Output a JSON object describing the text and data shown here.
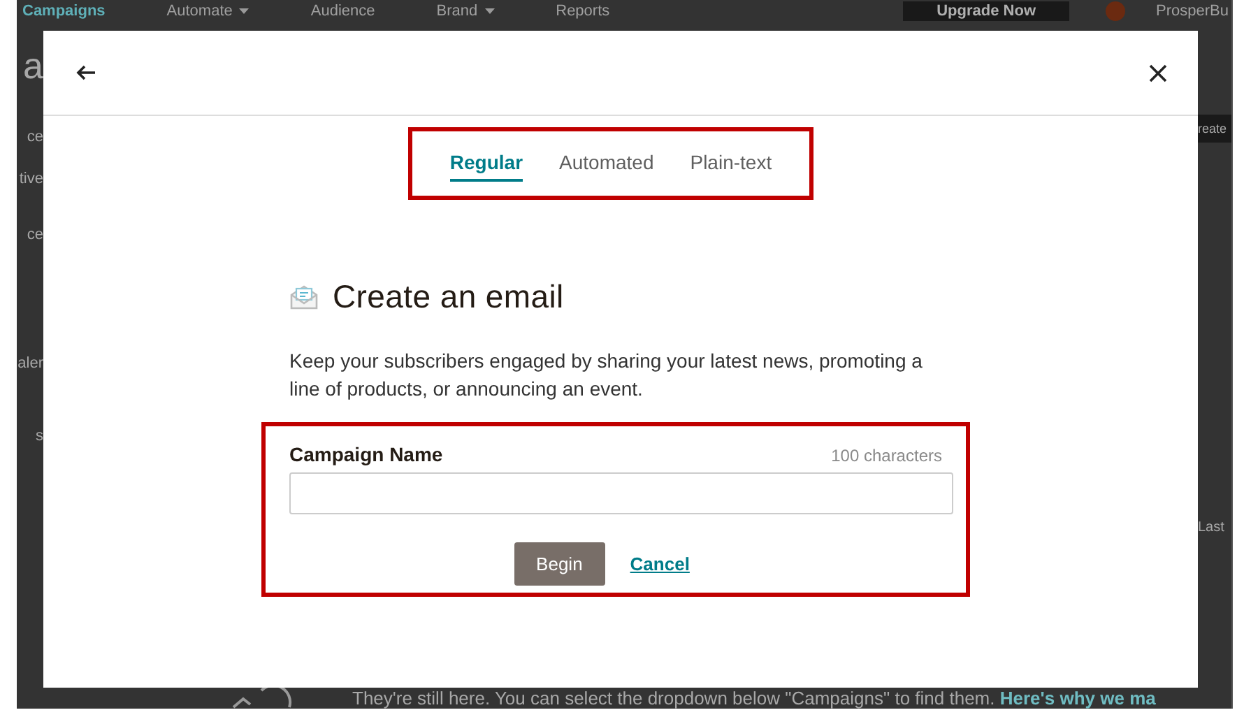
{
  "background": {
    "nav": [
      {
        "label": "Campaigns",
        "active": true,
        "dropdown": false
      },
      {
        "label": "Automate",
        "active": false,
        "dropdown": true
      },
      {
        "label": "Audience",
        "active": false,
        "dropdown": false
      },
      {
        "label": "Brand",
        "active": false,
        "dropdown": true
      },
      {
        "label": "Reports",
        "active": false,
        "dropdown": false
      }
    ],
    "upgrade_button": "Upgrade Now",
    "account_name": "ProsperBu",
    "left_fragments": [
      "a",
      "ce",
      "tive",
      "ce",
      "aler",
      "s"
    ],
    "right_fragments": [
      "reate",
      "Last"
    ],
    "notice": {
      "text": "They're still here. You can select the dropdown below \"Campaigns\" to find them.",
      "link": "Here's why we ma"
    }
  },
  "modal": {
    "tabs": [
      {
        "label": "Regular",
        "selected": true
      },
      {
        "label": "Automated",
        "selected": false
      },
      {
        "label": "Plain-text",
        "selected": false
      }
    ],
    "heading": "Create an email",
    "description": "Keep your subscribers engaged by sharing your latest news, promoting a line of products, or announcing an event.",
    "field": {
      "label": "Campaign Name",
      "counter": "100 characters"
    },
    "buttons": [
      {
        "kind": "primary",
        "label": "Begin"
      },
      {
        "kind": "link",
        "label": "Cancel"
      }
    ]
  }
}
